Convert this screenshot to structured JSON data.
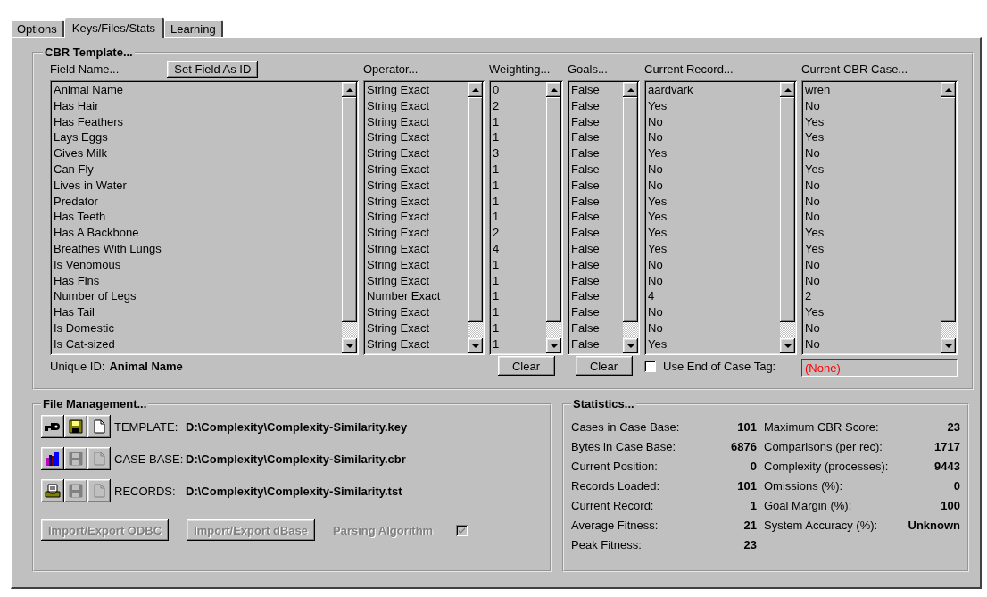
{
  "tabs": [
    {
      "label": "Options",
      "selected": false
    },
    {
      "label": "Keys/Files/Stats",
      "selected": true
    },
    {
      "label": "Learning",
      "selected": false
    }
  ],
  "cbr_template": {
    "title": "CBR Template...",
    "set_id_button": "Set Field As ID",
    "lists": [
      {
        "header": "Field Name...",
        "items": [
          "Animal Name",
          "Has Hair",
          "Has Feathers",
          "Lays Eggs",
          "Gives Milk",
          "Can Fly",
          "Lives in Water",
          "Predator",
          "Has Teeth",
          "Has A Backbone",
          "Breathes With Lungs",
          "Is Venomous",
          "Has Fins",
          "Number of Legs",
          "Has Tail",
          "Is Domestic",
          "Is Cat-sized"
        ]
      },
      {
        "header": "Operator...",
        "items": [
          "String Exact",
          "String Exact",
          "String Exact",
          "String Exact",
          "String Exact",
          "String Exact",
          "String Exact",
          "String Exact",
          "String Exact",
          "String Exact",
          "String Exact",
          "String Exact",
          "String Exact",
          "Number Exact",
          "String Exact",
          "String Exact",
          "String Exact"
        ]
      },
      {
        "header": "Weighting...",
        "items": [
          "0",
          "2",
          "1",
          "1",
          "3",
          "1",
          "1",
          "1",
          "1",
          "2",
          "4",
          "1",
          "1",
          "1",
          "1",
          "1",
          "1"
        ]
      },
      {
        "header": "Goals...",
        "items": [
          "False",
          "False",
          "False",
          "False",
          "False",
          "False",
          "False",
          "False",
          "False",
          "False",
          "False",
          "False",
          "False",
          "False",
          "False",
          "False",
          "False"
        ]
      },
      {
        "header": "Current Record...",
        "items": [
          "aardvark",
          "Yes",
          "No",
          "No",
          "Yes",
          "No",
          "No",
          "Yes",
          "Yes",
          "Yes",
          "Yes",
          "No",
          "No",
          "4",
          "No",
          "No",
          "Yes"
        ]
      },
      {
        "header": "Current CBR Case...",
        "items": [
          "wren",
          "No",
          "Yes",
          "Yes",
          "No",
          "Yes",
          "No",
          "No",
          "No",
          "Yes",
          "Yes",
          "No",
          "No",
          "2",
          "Yes",
          "No",
          "No"
        ]
      }
    ],
    "unique_id": {
      "label": "Unique ID:",
      "value": "Animal Name"
    },
    "clear_buttons": [
      "Clear",
      "Clear"
    ],
    "end_of_case_tag": {
      "label": "Use End of Case Tag:",
      "checked": false,
      "value": "(None)"
    }
  },
  "file_management": {
    "title": "File Management...",
    "rows": [
      {
        "label": "TEMPLATE:",
        "path": "D:\\Complexity\\Complexity-Similarity.key",
        "save_disabled": false,
        "new_disabled": false
      },
      {
        "label": "CASE BASE:",
        "path": "D:\\Complexity\\Complexity-Similarity.cbr",
        "save_disabled": true,
        "new_disabled": true
      },
      {
        "label": "RECORDS:",
        "path": "D:\\Complexity\\Complexity-Similarity.tst",
        "save_disabled": true,
        "new_disabled": true
      }
    ],
    "buttons": [
      {
        "label": "Import/Export ODBC",
        "disabled": true
      },
      {
        "label": "Import/Export dBase",
        "disabled": true
      }
    ],
    "parsing": {
      "label": "Parsing Algorithm",
      "checked": true,
      "disabled": true
    }
  },
  "statistics": {
    "title": "Statistics...",
    "left": [
      {
        "label": "Cases in Case Base:",
        "value": "101"
      },
      {
        "label": "Bytes in Case Base:",
        "value": "6876"
      },
      {
        "label": "Current Position:",
        "value": "0"
      },
      {
        "label": "Records Loaded:",
        "value": "101"
      },
      {
        "label": "Current Record:",
        "value": "1"
      },
      {
        "label": "Average Fitness:",
        "value": "21"
      },
      {
        "label": "Peak Fitness:",
        "value": "23"
      }
    ],
    "right": [
      {
        "label": "Maximum CBR Score:",
        "value": "23"
      },
      {
        "label": "Comparisons (per rec):",
        "value": "1717"
      },
      {
        "label": "Complexity (processes):",
        "value": "9443"
      },
      {
        "label": "Omissions (%):",
        "value": "0"
      },
      {
        "label": "Goal Margin (%):",
        "value": "100"
      },
      {
        "label": "System Accuracy (%):",
        "value": "Unknown"
      }
    ]
  }
}
